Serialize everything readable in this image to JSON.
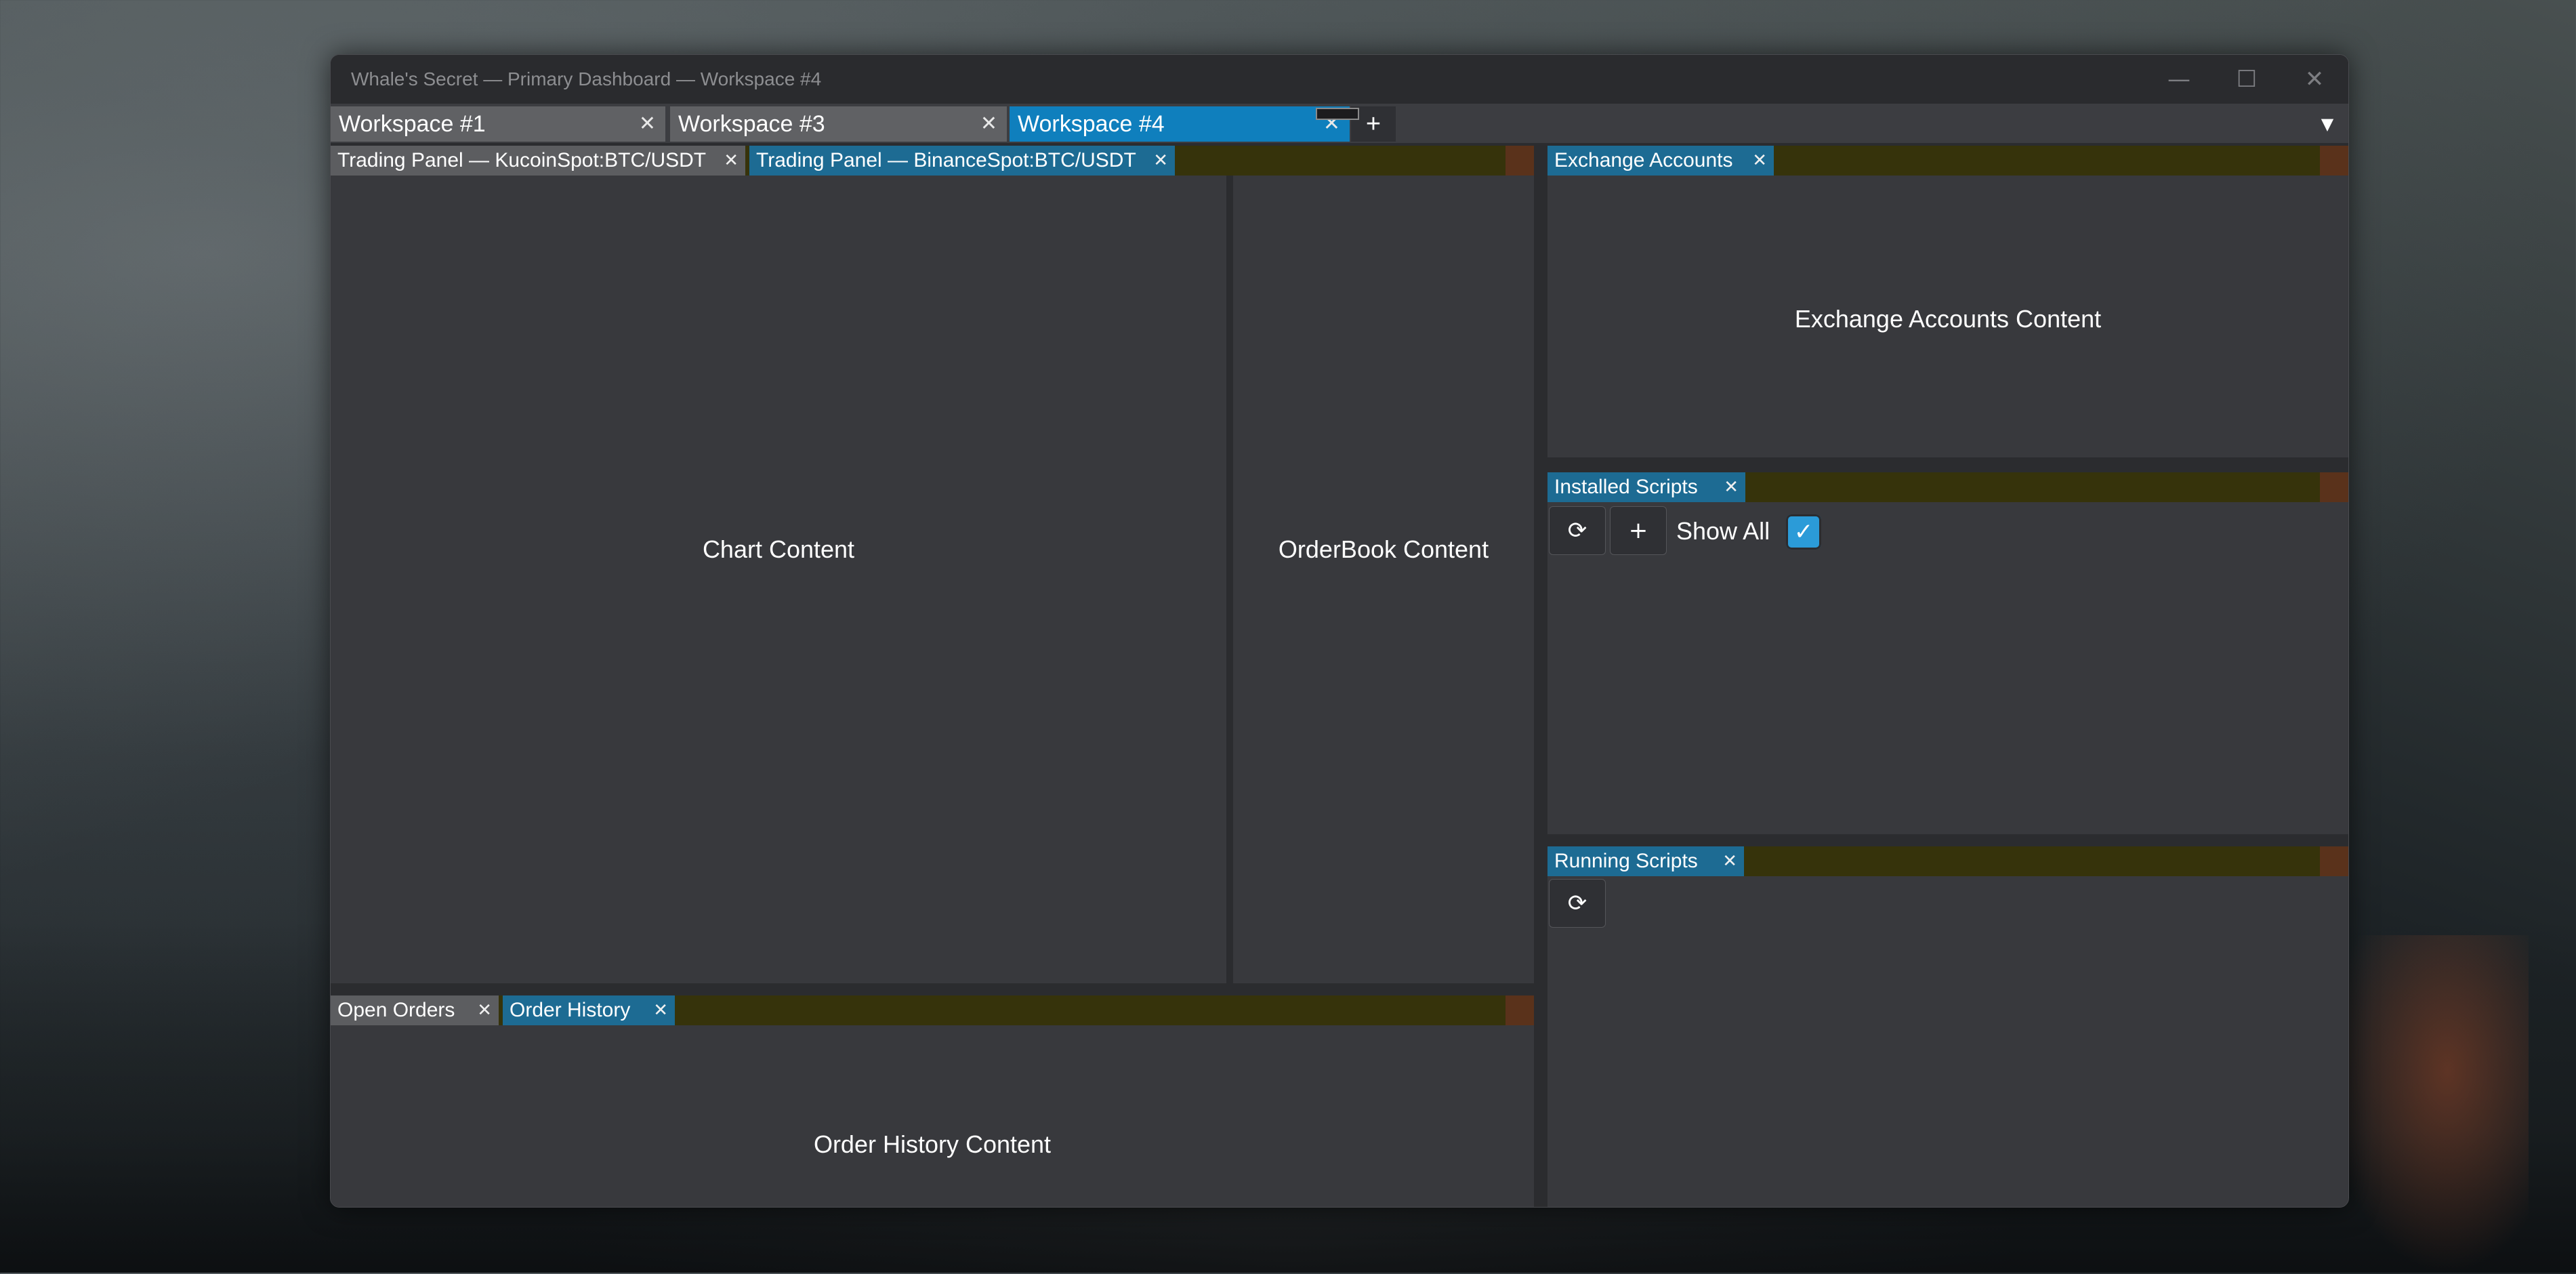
{
  "window": {
    "title": "Whale's Secret — Primary Dashboard — Workspace #4",
    "controls": {
      "minimize": "—",
      "maximize": "☐",
      "close": "✕"
    }
  },
  "workspace_tabs": [
    {
      "label": "Workspace #1",
      "close": "✕",
      "active": false
    },
    {
      "label": "Workspace #3",
      "close": "✕",
      "active": false
    },
    {
      "label": "Workspace #4",
      "close": "✕",
      "active": true
    }
  ],
  "workspace_add": "+",
  "workspace_menu": "▼",
  "trading_panels": {
    "tabs": [
      {
        "label": "Trading Panel — KucoinSpot:BTC/USDT",
        "close": "✕",
        "active": false
      },
      {
        "label": "Trading Panel — BinanceSpot:BTC/USDT",
        "close": "✕",
        "active": true
      }
    ],
    "chart_content": "Chart Content",
    "orderbook_content": "OrderBook Content"
  },
  "orders": {
    "tabs": [
      {
        "label": "Open Orders",
        "close": "✕",
        "active": false
      },
      {
        "label": "Order History",
        "close": "✕",
        "active": true
      }
    ],
    "content": "Order History Content"
  },
  "exchange_accounts": {
    "tab": {
      "label": "Exchange Accounts",
      "close": "✕"
    },
    "content": "Exchange Accounts Content"
  },
  "installed_scripts": {
    "tab": {
      "label": "Installed Scripts",
      "close": "✕"
    },
    "refresh_icon": "⟳",
    "add_icon": "+",
    "show_all_label": "Show All",
    "show_all_checked": true,
    "check_glyph": "✓"
  },
  "running_scripts": {
    "tab": {
      "label": "Running Scripts",
      "close": "✕"
    },
    "refresh_icon": "⟳"
  },
  "colors": {
    "accent": "#0f7fbd",
    "panel_tab_active": "#1d6b93",
    "panel_tabbar": "#36330b",
    "panel_bg": "#38393d"
  }
}
